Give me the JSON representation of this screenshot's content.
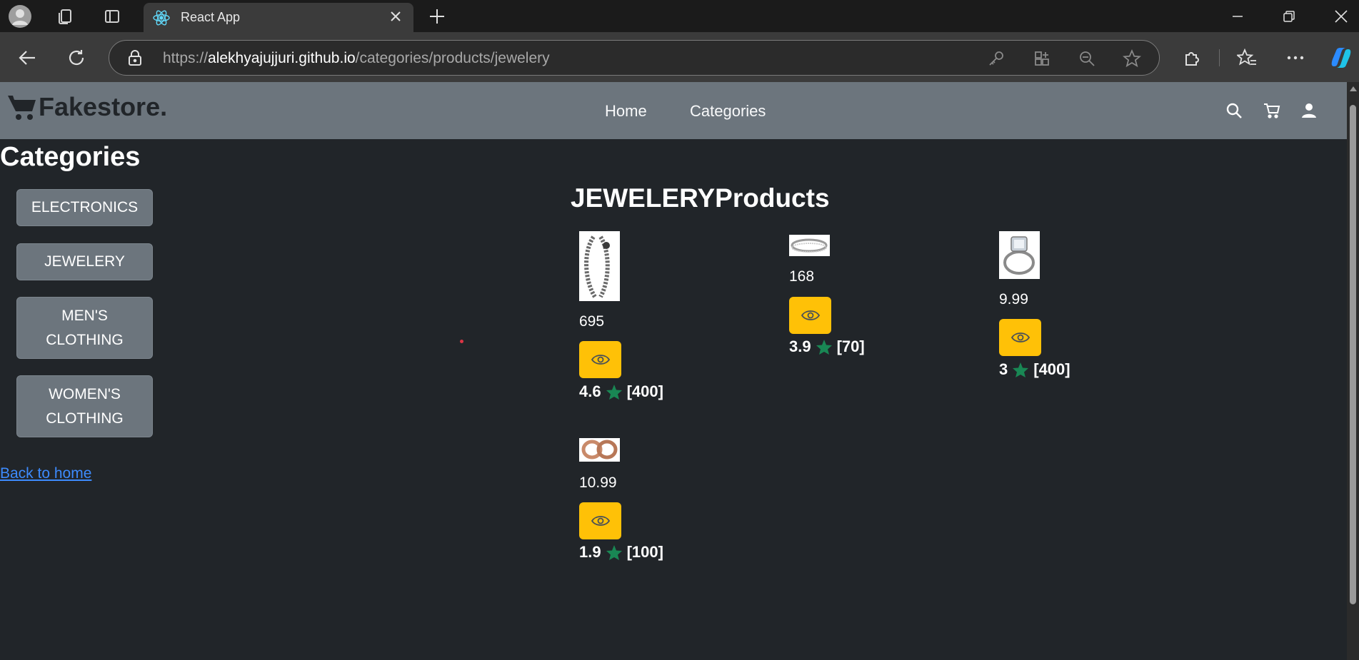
{
  "browser": {
    "tab_title": "React App",
    "url_scheme": "https://",
    "url_host": "alekhyajujjuri.github.io",
    "url_path": "/categories/products/jewelery"
  },
  "navbar": {
    "brand": "Fakestore.",
    "links": [
      "Home",
      "Categories"
    ]
  },
  "sidebar": {
    "heading": "Categories",
    "categories": [
      "ELECTRONICS",
      "JEWELERY",
      "MEN'S CLOTHING",
      "WOMEN'S CLOTHING"
    ],
    "back_link": "Back to home"
  },
  "products": {
    "heading": "JEWELERYProducts",
    "items": [
      {
        "price": "695",
        "rate": "4.6",
        "count": "[400]",
        "image": "chain-bracelet"
      },
      {
        "price": "168",
        "rate": "3.9",
        "count": "[70]",
        "image": "silver-bangle"
      },
      {
        "price": "9.99",
        "rate": "3",
        "count": "[400]",
        "image": "diamond-ring"
      },
      {
        "price": "10.99",
        "rate": "1.9",
        "count": "[100]",
        "image": "rose-gold-rings"
      }
    ]
  },
  "colors": {
    "navbar_bg": "#6c757d",
    "page_bg": "#212529",
    "view_button": "#ffc107",
    "star": "#198754",
    "link": "#3d8bfd"
  }
}
